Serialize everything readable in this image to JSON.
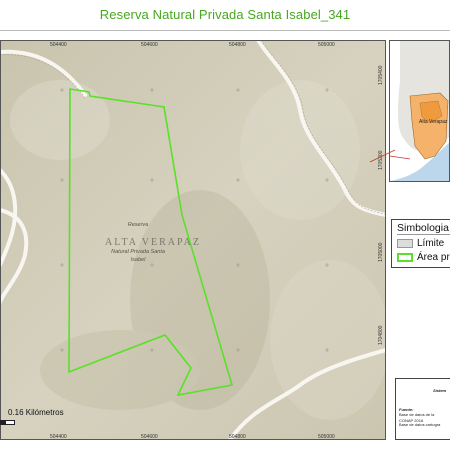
{
  "title": "Reserva Natural Privada Santa Isabel_341",
  "map": {
    "region_label": "ALTA VERAPAZ",
    "reserve_label": [
      "Reserva",
      "Natural Privada Santa",
      "Isabel"
    ],
    "grid_x_labels": [
      "504400",
      "504600",
      "504800",
      "505000"
    ],
    "grid_y_labels": [
      "1705400",
      "1705200",
      "1705000",
      "1704800"
    ],
    "scale_label": "0.16 Kilómetros",
    "colors": {
      "boundary": "#5be02a",
      "terrain": "#d4d0bd",
      "road": "#f7f6f1"
    }
  },
  "inset": {
    "region_label": "Alta Verapaz"
  },
  "legend": {
    "title": "Simbologia",
    "items": [
      {
        "label": "Límite",
        "swatch": "gray"
      },
      {
        "label": "Área pr",
        "swatch": "green"
      }
    ]
  },
  "info": {
    "system_label": "Sistem",
    "source_heading": "Fuente:",
    "source_line1": "Base de datos de la",
    "source_line2": "CONAP 2016",
    "source_line3": "Base de datos cartogra"
  }
}
